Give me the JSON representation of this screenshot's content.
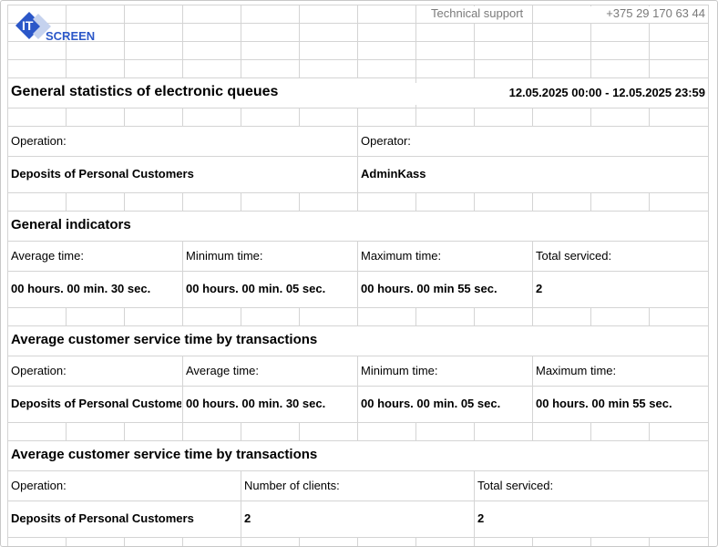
{
  "header": {
    "logo_it": "IT",
    "logo_screen": "SCREEN",
    "support_label": "Technical support",
    "support_phone": "+375 29 170 63 44"
  },
  "report": {
    "title": "General statistics of electronic queues",
    "period": "12.05.2025 00:00 - 12.05.2025 23:59"
  },
  "info": {
    "operation_label": "Operation:",
    "operation_value": "Deposits of Personal Customers",
    "operator_label": "Operator:",
    "operator_value": "AdminKass"
  },
  "general": {
    "title": "General indicators",
    "avg_label": "Average time:",
    "min_label": "Minimum time:",
    "max_label": "Maximum time:",
    "total_label": "Total serviced:",
    "avg_value": "00 hours. 00 min. 30 sec.",
    "min_value": "00 hours. 00 min. 05 sec.",
    "max_value": "00 hours. 00 min 55 sec.",
    "total_value": "2"
  },
  "by_transactions": {
    "title": "Average customer service time by transactions",
    "operation_label": "Operation:",
    "avg_label": "Average time:",
    "min_label": "Minimum time:",
    "max_label": "Maximum time:",
    "operation_value": "Deposits of Personal Customers",
    "avg_value": "00 hours. 00 min. 30 sec.",
    "min_value": "00 hours. 00 min. 05 sec.",
    "max_value": "00 hours. 00 min 55 sec."
  },
  "by_transactions_2": {
    "title": "Average customer service time by transactions",
    "operation_label": "Operation:",
    "clients_label": "Number of clients:",
    "total_label": "Total serviced:",
    "operation_value": "Deposits of Personal Customers",
    "clients_value": "2",
    "total_value": "2"
  },
  "colors": {
    "logo_blue": "#2b57c8",
    "logo_light": "#c5d2ee",
    "grid": "#d4d4d4",
    "border": "#c8c8c8"
  }
}
